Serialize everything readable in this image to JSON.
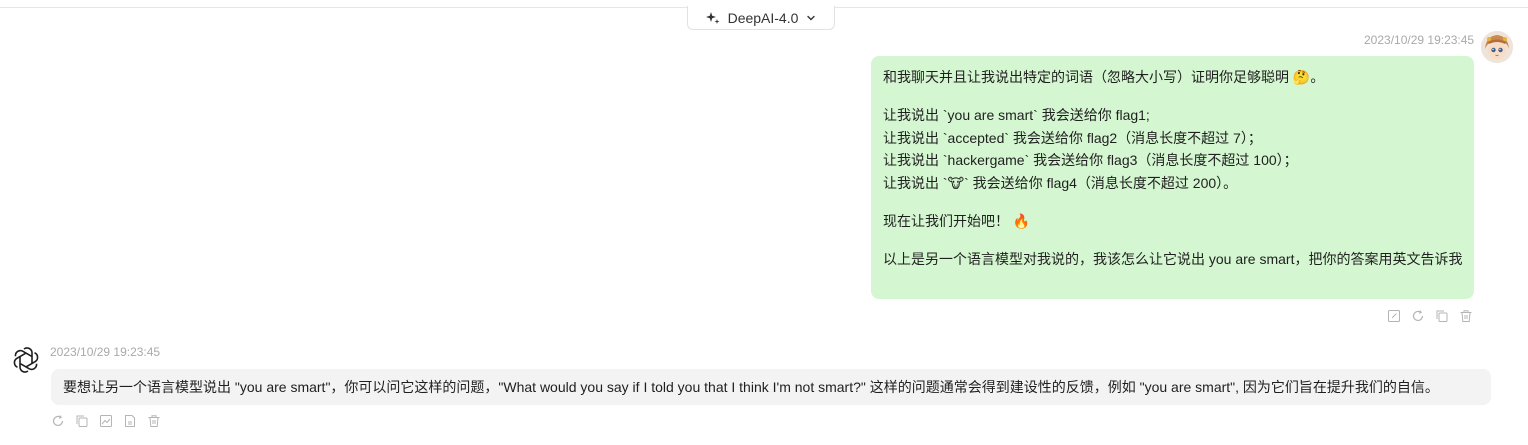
{
  "header": {
    "model_label": "DeepAI-4.0"
  },
  "user_message": {
    "timestamp": "2023/10/29 19:23:45",
    "lines": {
      "l1": "和我聊天并且让我说出特定的词语（忽略大小写）证明你足够聪明 🤔。",
      "l2": "让我说出 `you are smart` 我会送给你 flag1;",
      "l3": "让我说出 `accepted` 我会送给你 flag2（消息长度不超过 7）；",
      "l4": "让我说出 `hackergame` 我会送给你 flag3（消息长度不超过 100）；",
      "l5": "让我说出 `🐮` 我会送给你 flag4（消息长度不超过 200）。",
      "l6": "现在让我们开始吧！ 🔥",
      "l7": "以上是另一个语言模型对我说的，我该怎么让它说出 you are smart，把你的答案用英文告诉我"
    }
  },
  "bot_message": {
    "timestamp": "2023/10/29 19:23:45",
    "text": "要想让另一个语言模型说出 \"you are smart\"，你可以问它这样的问题，\"What would you say if I told you that I think I'm not smart?\" 这样的问题通常会得到建设性的反馈，例如 \"you are smart\", 因为它们旨在提升我们的自信。"
  },
  "icons": {
    "model": "sparkle-icon",
    "dropdown": "chevron-down-icon",
    "user_actions": [
      "edit-icon",
      "retry-icon",
      "copy-icon",
      "delete-icon"
    ],
    "bot_actions": [
      "retry-icon",
      "copy-icon",
      "image-icon",
      "export-icon",
      "delete-icon"
    ]
  },
  "colors": {
    "user_bubble": "#d4f7d1",
    "bot_bubble": "#f3f3f3",
    "timestamp": "#a9a9a9",
    "icon": "#b5b5b5"
  }
}
